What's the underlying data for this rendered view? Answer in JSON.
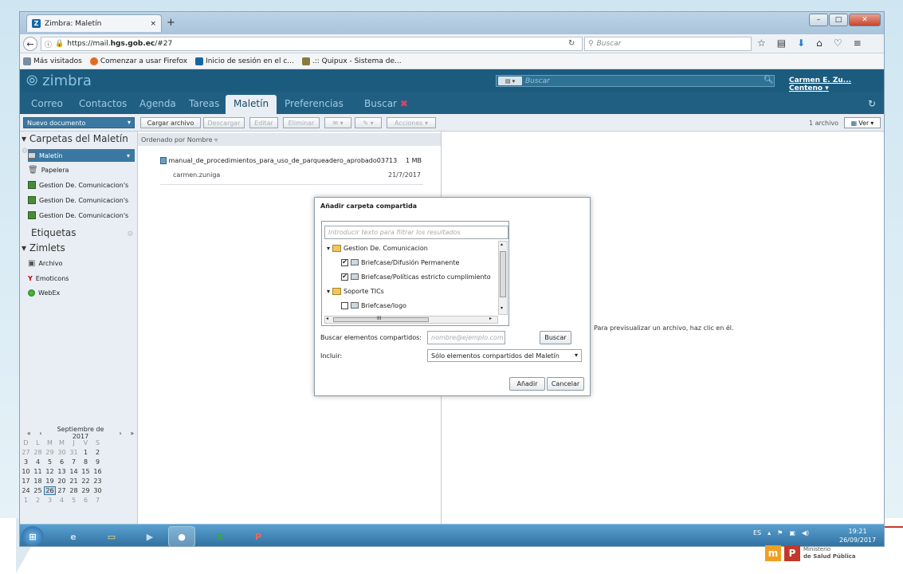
{
  "browser": {
    "tab_title": "Zimbra: Maletín",
    "new_tab": "+",
    "url_prefix": "https://mail.",
    "url_domain": "hgs.gob.ec",
    "url_suffix": "/#27",
    "search_placeholder": "Buscar",
    "bookmarks": [
      "Más visitados",
      "Comenzar a usar Firefox",
      "Inicio de sesión en el c...",
      ".:: Quipux - Sistema de..."
    ]
  },
  "zimbra": {
    "brand": "zimbra",
    "search_placeholder": "Buscar",
    "user": "Carmen E. Zu... Centeno",
    "apps": [
      "Correo",
      "Contactos",
      "Agenda",
      "Tareas",
      "Maletín",
      "Preferencias",
      "Buscar"
    ],
    "active_app": "Maletín"
  },
  "toolbar": {
    "new_doc": "Nuevo documento",
    "upload": "Cargar archivo",
    "download": "Descargar",
    "edit": "Editar",
    "delete": "Eliminar",
    "actions": "Acciones",
    "file_count": "1 archivo",
    "view": "Ver"
  },
  "sidebar": {
    "header_folders": "Carpetas del Maletín",
    "folders": [
      "Maletín",
      "Papelera",
      "Gestion De. Comunicacion's",
      "Gestion De. Comunicacion's",
      "Gestion De. Comunicacion's"
    ],
    "header_tags": "Etiquetas",
    "header_zimlets": "Zimlets",
    "zimlets": [
      "Archivo",
      "Emoticons",
      "WebEx"
    ]
  },
  "calendar": {
    "month": "Septiembre de 2017",
    "weekdays": [
      "D",
      "L",
      "M",
      "M",
      "J",
      "V",
      "S"
    ],
    "weeks": [
      [
        "27",
        "28",
        "29",
        "30",
        "31",
        "1",
        "2"
      ],
      [
        "3",
        "4",
        "5",
        "6",
        "7",
        "8",
        "9"
      ],
      [
        "10",
        "11",
        "12",
        "13",
        "14",
        "15",
        "16"
      ],
      [
        "17",
        "18",
        "19",
        "20",
        "21",
        "22",
        "23"
      ],
      [
        "24",
        "25",
        "26",
        "27",
        "28",
        "29",
        "30"
      ],
      [
        "1",
        "2",
        "3",
        "4",
        "5",
        "6",
        "7"
      ]
    ],
    "today": "26"
  },
  "list": {
    "sort_label": "Ordenado por Nombre",
    "file_name": "manual_de_procedimientos_para_uso_de_parqueadero_aprobado03713",
    "file_size": "1 MB",
    "owner": "carmen.zuniga",
    "date": "21/7/2017"
  },
  "preview": {
    "hint": "Para previsualizar un archivo, haz clic en él."
  },
  "dialog": {
    "title": "Añadir carpeta compartida",
    "filter_placeholder": "Introducir texto para filtrar los resultados",
    "tree": [
      {
        "label": "Gestion De. Comunicacion",
        "type": "group"
      },
      {
        "label": "Briefcase/Difusión Permanente",
        "type": "item",
        "checked": true
      },
      {
        "label": "Briefcase/Políticas estricto cumplimiento",
        "type": "item",
        "checked": true
      },
      {
        "label": "Soporte TICs",
        "type": "group"
      },
      {
        "label": "Briefcase/logo",
        "type": "item",
        "checked": false
      }
    ],
    "scroll_mid": "III",
    "search_label": "Buscar elementos compartidos:",
    "search_placeholder": "nombre@ejemplo.com",
    "search_button": "Buscar",
    "include_label": "Incluir:",
    "include_value": "Sólo elementos compartidos del Maletín",
    "add_button": "Añadir",
    "cancel_button": "Cancelar"
  },
  "taskbar": {
    "lang": "ES",
    "time": "19:21",
    "date": "26/09/2017"
  },
  "branding": {
    "line1": "Ministerio",
    "line2": "de Salud Pública"
  }
}
